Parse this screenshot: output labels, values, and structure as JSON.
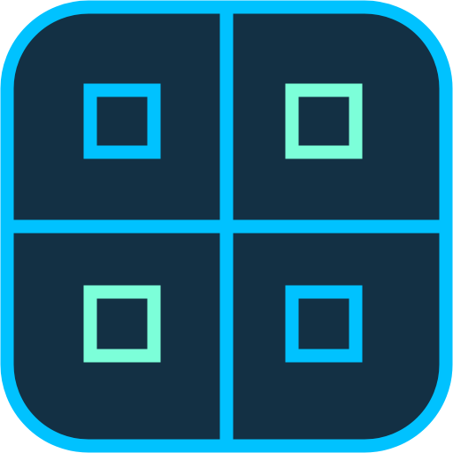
{
  "icon": {
    "name": "grid-layout-icon",
    "colors": {
      "background": "#ffffff",
      "tile_fill": "#133044",
      "frame_stroke": "#00c2ff",
      "accent_cyan": "#00c2ff",
      "accent_mint": "#7cffd9"
    },
    "cells": [
      {
        "name": "cell-top-left",
        "accent": "cyan"
      },
      {
        "name": "cell-top-right",
        "accent": "mint"
      },
      {
        "name": "cell-bottom-left",
        "accent": "mint"
      },
      {
        "name": "cell-bottom-right",
        "accent": "cyan"
      }
    ]
  }
}
